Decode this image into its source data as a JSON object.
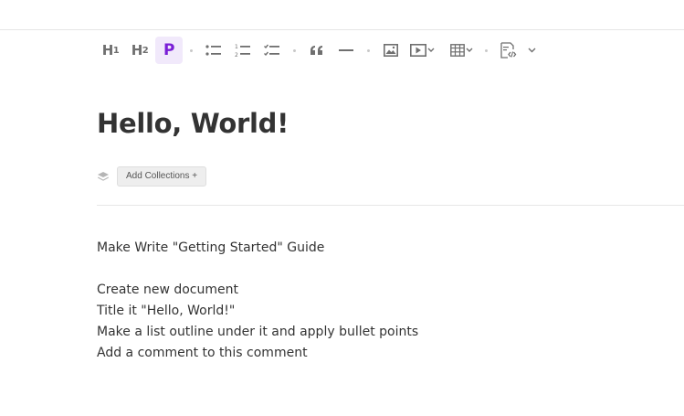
{
  "toolbar": {
    "heading1": {
      "letter": "H",
      "level": "1"
    },
    "heading2": {
      "letter": "H",
      "level": "2"
    },
    "paragraph": "P",
    "accent_color": "#7a1fd6",
    "icons": [
      "bulleted-list-icon",
      "numbered-list-icon",
      "checklist-icon",
      "blockquote-icon",
      "horizontal-rule-icon",
      "image-icon",
      "video-icon",
      "table-icon",
      "code-embed-icon"
    ]
  },
  "document": {
    "title": "Hello, World!",
    "add_collections_label": "Add Collections +",
    "lines": [
      "Make Write \"Getting Started\" Guide",
      "",
      "Create new document",
      "Title it \"Hello, World!\"",
      "Make a list outline under it and apply bullet points",
      "Add a comment to this comment"
    ]
  }
}
